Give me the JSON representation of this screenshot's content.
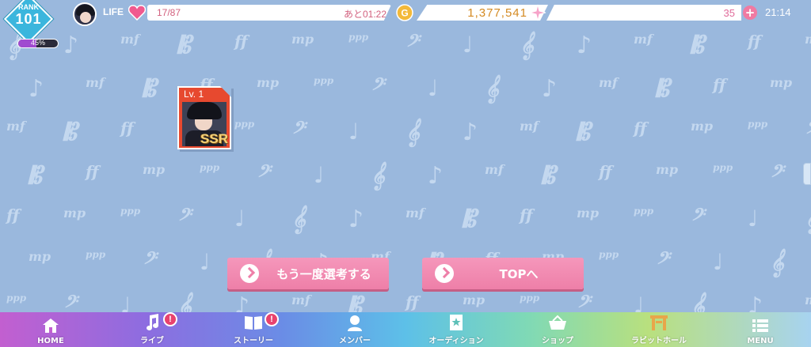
{
  "header": {
    "rank_label": "RANK",
    "rank_value": "101",
    "exp_text": "45%",
    "exp_fraction": 0.45,
    "life_label": "LIFE",
    "life_value": "17/87",
    "life_timer": "あと01:22",
    "coins": "1,377,541",
    "gems": "35",
    "plus": "+",
    "clock": "21:14",
    "icons": [
      "heart-icon",
      "coin-icon",
      "sparkle-icon",
      "plus-icon"
    ]
  },
  "card": {
    "level": "Lv. 1",
    "rarity": "SSR"
  },
  "actions": {
    "retry_label": "もう一度選考する",
    "top_label": "TOPへ"
  },
  "nav": {
    "items": [
      {
        "label": "HOME",
        "icon": "home-icon",
        "badge": ""
      },
      {
        "label": "ライブ",
        "icon": "music-note-icon",
        "badge": "!"
      },
      {
        "label": "ストーリー",
        "icon": "book-icon",
        "badge": "!"
      },
      {
        "label": "メンバー",
        "icon": "member-icon",
        "badge": ""
      },
      {
        "label": "オーディション",
        "icon": "audition-card-icon",
        "badge": ""
      },
      {
        "label": "ショップ",
        "icon": "basket-icon",
        "badge": ""
      },
      {
        "label": "ラビットホール",
        "icon": "stage-gate-icon",
        "badge": ""
      },
      {
        "label": "MENU",
        "icon": "menu-icon",
        "badge": ""
      }
    ]
  },
  "colors": {
    "background": "#9ab8dd",
    "accent_pink": "#ee7fa8",
    "rank_blue": "#3bb6dd",
    "card_red": "#e7492f"
  }
}
